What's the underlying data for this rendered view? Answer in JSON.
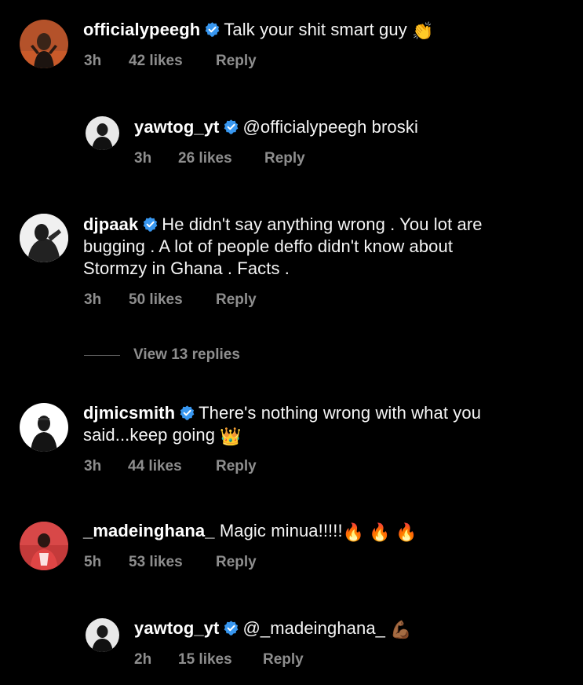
{
  "comments": [
    {
      "username": "officialypeegh",
      "text": "Talk your shit smart guy",
      "emoji": "👏",
      "time": "3h",
      "likes": "42 likes",
      "reply": "Reply"
    },
    {
      "username": "yawtog_yt",
      "text": "@officialypeegh broski",
      "time": "3h",
      "likes": "26 likes",
      "reply": "Reply"
    },
    {
      "username": "djpaak",
      "text_line1": "He didn't say anything wrong . You lot are",
      "text_line2": "bugging . A lot of people deffo didn't know about",
      "text_line3": "Stormzy in Ghana . Facts .",
      "time": "3h",
      "likes": "50 likes",
      "reply": "Reply"
    },
    {
      "username": "djmicsmith",
      "text_line1": "There's nothing wrong with what you",
      "text_line2": "said...keep going",
      "emoji": "👑",
      "time": "3h",
      "likes": "44 likes",
      "reply": "Reply"
    },
    {
      "username": "_madeinghana_",
      "text": "Magic minua!!!!!",
      "emoji": "🔥 🔥 🔥",
      "time": "5h",
      "likes": "53 likes",
      "reply": "Reply"
    },
    {
      "username": "yawtog_yt",
      "text": "@_madeinghana_",
      "emoji": "💪🏾",
      "time": "2h",
      "likes": "15 likes",
      "reply": "Reply"
    }
  ],
  "view_replies": "View 13 replies",
  "icons": {
    "verified": "verified-badge-icon"
  },
  "colors": {
    "background": "#000000",
    "text": "#ffffff",
    "secondary": "#8e8e8e",
    "verified": "#3897f0"
  }
}
